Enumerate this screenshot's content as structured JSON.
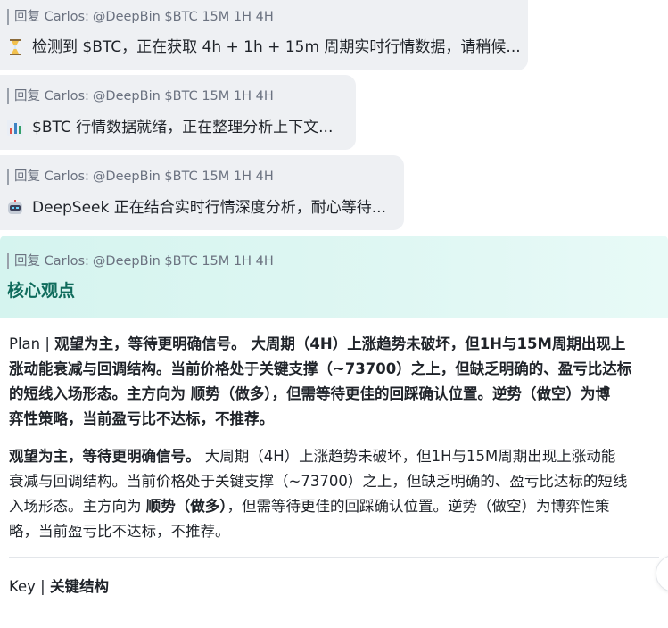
{
  "messages": [
    {
      "reply_prefix": "回复 Carlos:",
      "reply_handle": "@DeepBin $BTC 15M 1H 4H",
      "icon": "hourglass-icon",
      "text": "检测到 $BTC，正在获取 4h + 1h + 15m 周期实时行情数据，请稍候..."
    },
    {
      "reply_prefix": "回复 Carlos:",
      "reply_handle": "@DeepBin $BTC 15M 1H 4H",
      "icon": "bar-chart-icon",
      "text": "$BTC 行情数据就绪，正在整理分析上下文..."
    },
    {
      "reply_prefix": "回复 Carlos:",
      "reply_handle": "@DeepBin $BTC 15M 1H 4H",
      "icon": "robot-icon",
      "text": "DeepSeek 正在结合实时行情深度分析，耐心等待..."
    }
  ],
  "result": {
    "reply_prefix": "回复 Carlos:",
    "reply_handle": "@DeepBin $BTC 15M 1H 4H",
    "title": "核心观点",
    "plan_line1": "Plan | 观望为主，等待更明确信号。 大周期（4H）上涨趋势未破坏，但1H与15M周期出现上",
    "plan_line2": "涨动能衰减与回调结构。当前价格处于关键支撑（~73700）之上，但缺乏明确的、盈亏比达标",
    "plan_line3": "的短线入场形态。主方向为 顺势（做多），但需等待更佳的回踩确认位置。逆势（做空）为博",
    "plan_line4": "弈性策略，当前盈亏比不达标，不推荐。",
    "detail_bold1": "观望为主，等待更明确信号。",
    "detail_line1_rest": " 大周期（4H）上涨趋势未破坏，但1H与15M周期出现上涨动能",
    "detail_line2": "衰减与回调结构。当前价格处于关键支撑（~73700）之上，但缺乏明确的、盈亏比达标的短线",
    "detail_line3_pre": "入场形态。主方向为 ",
    "detail_bold2": "顺势（做多）",
    "detail_line3_post": "，但需等待更佳的回踩确认位置。逆势（做空）为博弈性策",
    "detail_line4": "略，当前盈亏比不达标，不推荐。",
    "key_prefix": "Key | ",
    "key_label": "关键结构"
  },
  "colors": {
    "bubble_bg": "#eef0f3",
    "title_green": "#0f6b5c",
    "header_gradient_start": "#d5f4ef"
  }
}
